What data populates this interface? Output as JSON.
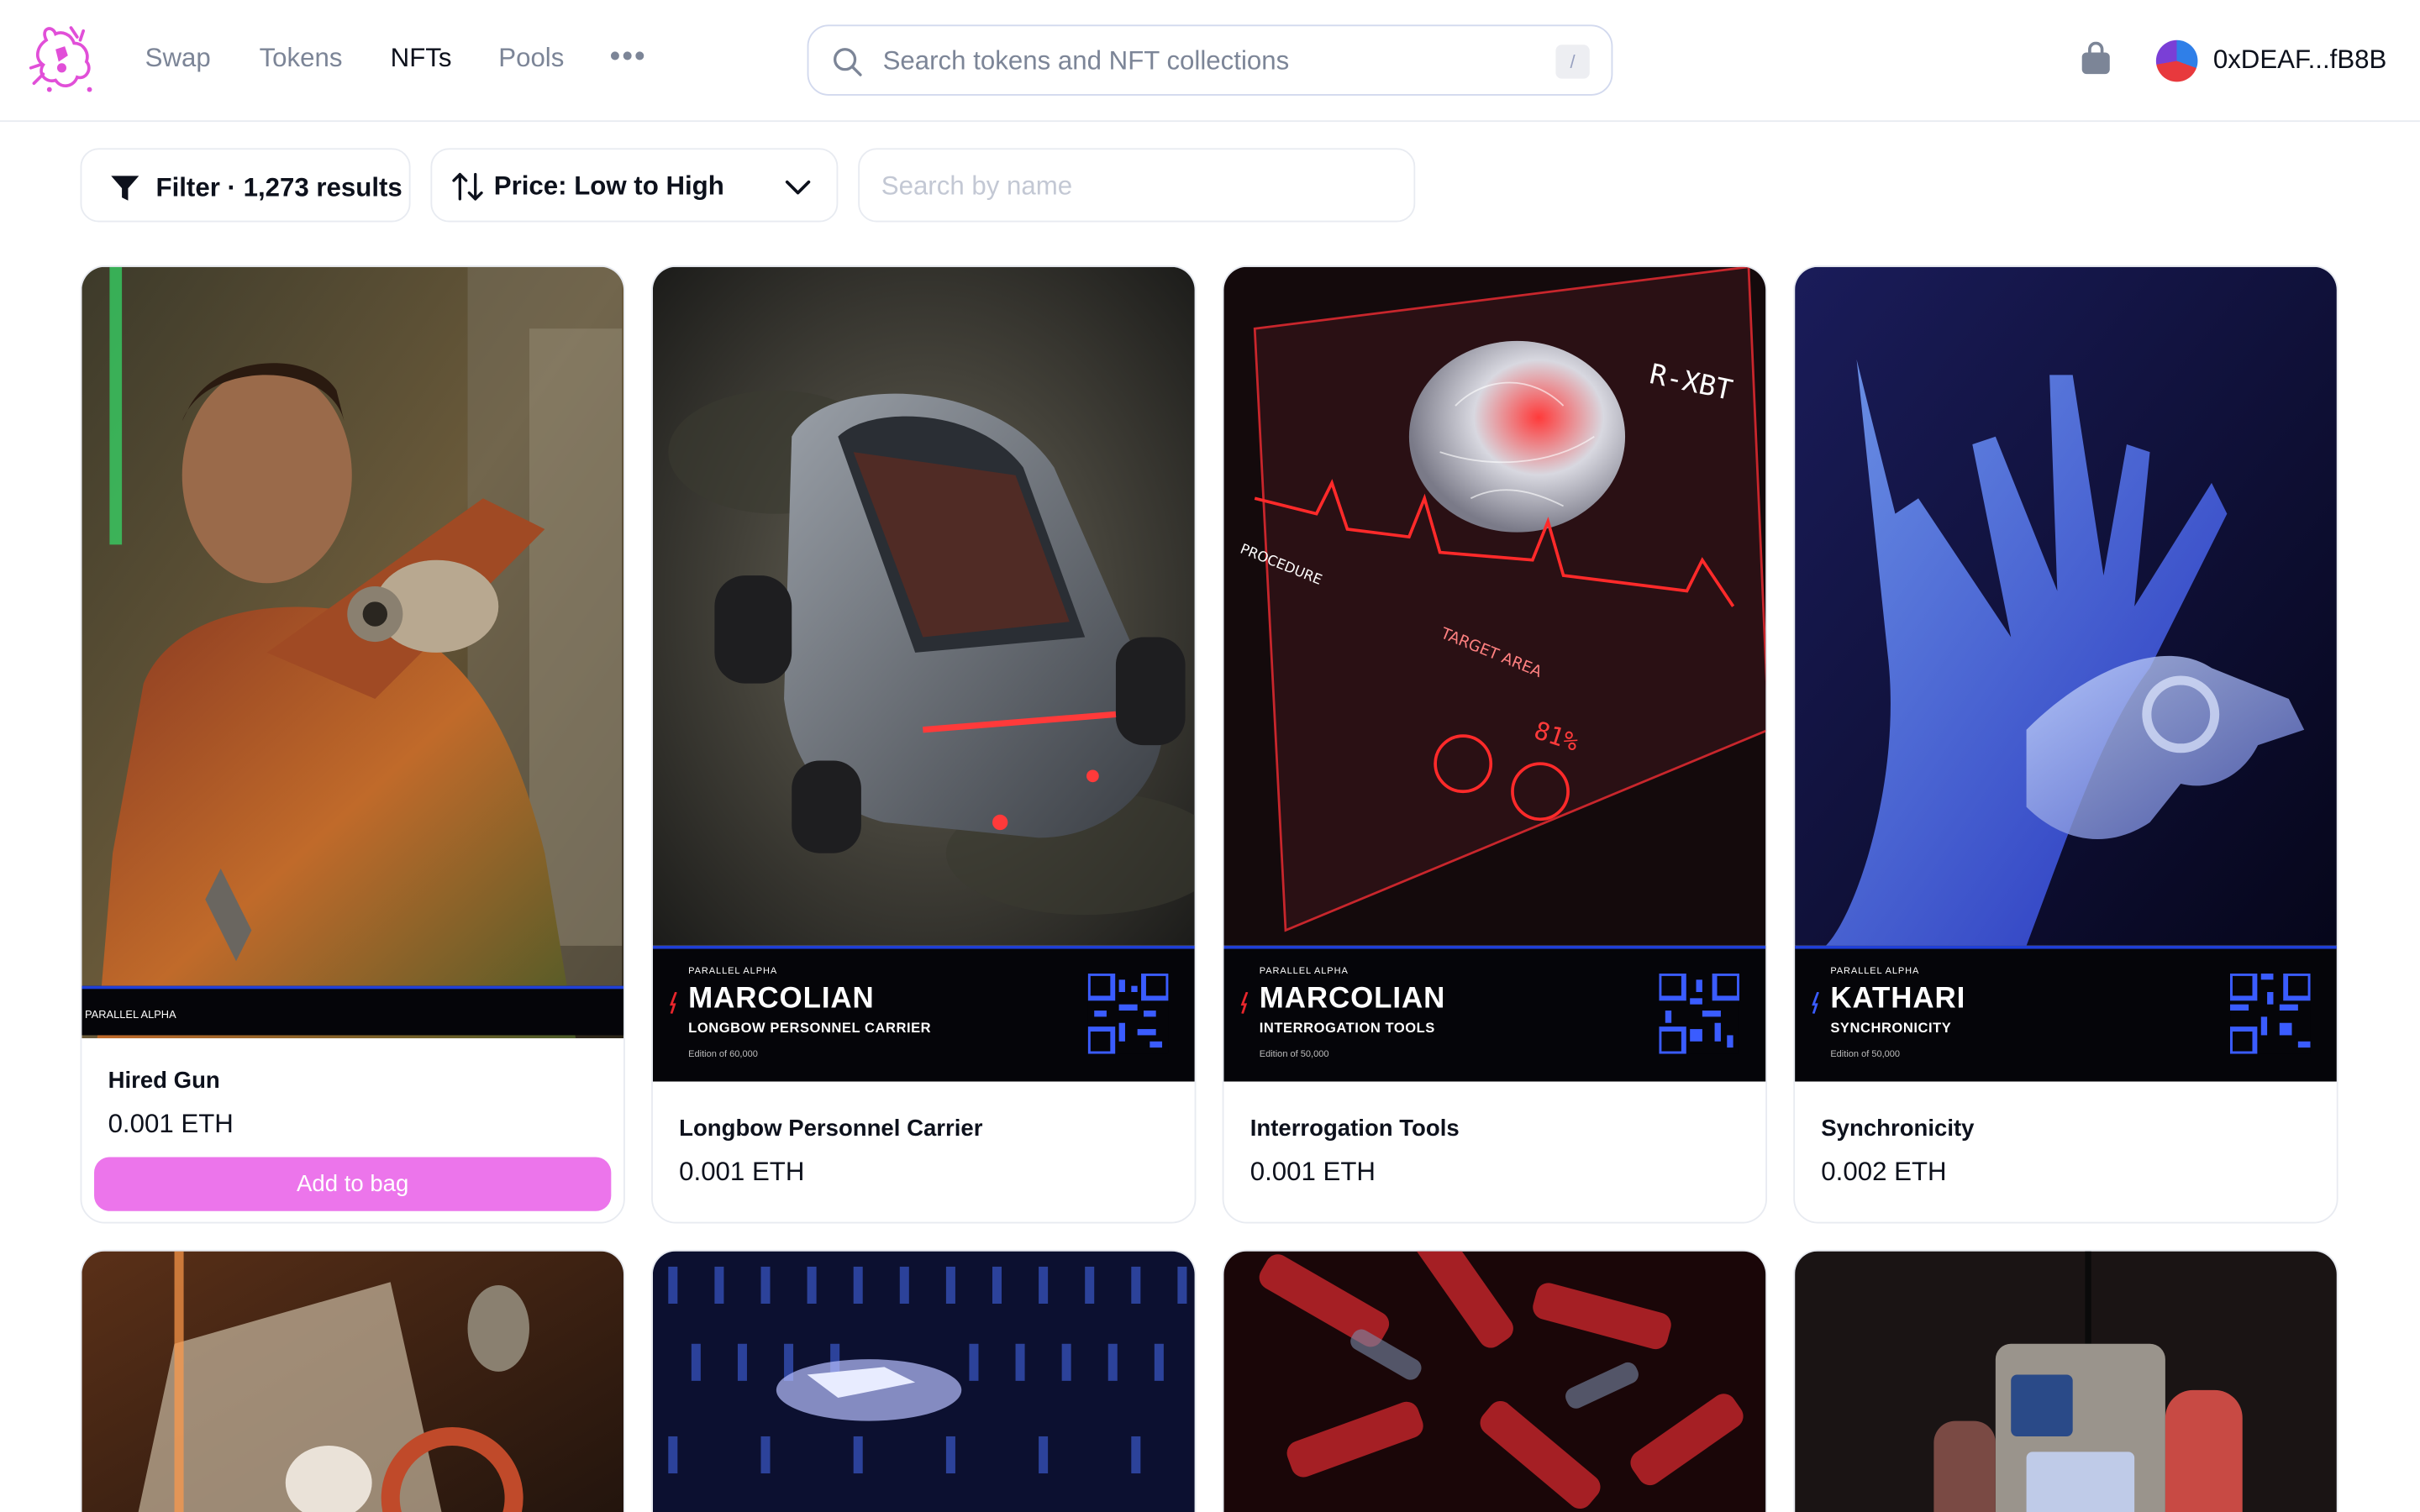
{
  "nav": {
    "links": [
      "Swap",
      "Tokens",
      "NFTs",
      "Pools"
    ],
    "active": "NFTs",
    "more": "•••"
  },
  "search": {
    "placeholder": "Search tokens and NFT collections",
    "shortcut": "/"
  },
  "wallet": {
    "address": "0xDEAF...fB8B"
  },
  "filters": {
    "filter_label": "Filter · 1,273 results",
    "sort_label": "Price: Low to High",
    "name_search_placeholder": "Search by name"
  },
  "cards": [
    {
      "name": "Hired Gun",
      "price": "0.001 ETH",
      "add_label": "Add to bag",
      "band_text": "PARALLEL ALPHA"
    },
    {
      "name": "Longbow Personnel Carrier",
      "price": "0.001 ETH",
      "band": {
        "pa": "PARALLEL ALPHA",
        "title": "MARCOLIAN",
        "subtitle": "LONGBOW PERSONNEL CARRIER",
        "edition": "Edition of 60,000"
      }
    },
    {
      "name": "Interrogation Tools",
      "price": "0.001 ETH",
      "band": {
        "pa": "PARALLEL ALPHA",
        "title": "MARCOLIAN",
        "subtitle": "INTERROGATION TOOLS",
        "edition": "Edition of 50,000"
      }
    },
    {
      "name": "Synchronicity",
      "price": "0.002 ETH",
      "band": {
        "pa": "PARALLEL ALPHA",
        "title": "KATHARI",
        "subtitle": "SYNCHRONICITY",
        "edition": "Edition of 50,000"
      }
    }
  ],
  "colors": {
    "accent_pink": "#ec75eb",
    "band_blue": "#1f3fd8",
    "marcolian_red": "#e8262c",
    "kathari_blue": "#3a5cff"
  }
}
